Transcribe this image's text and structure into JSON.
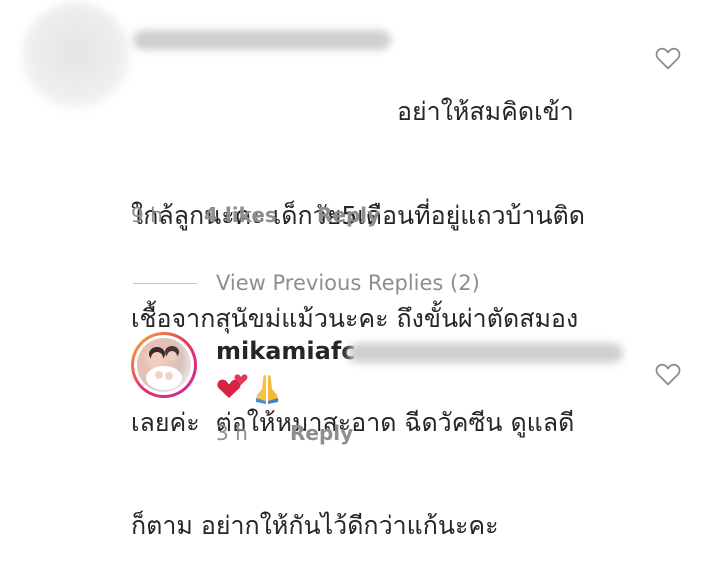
{
  "comment": {
    "lines": [
      "อย่าให้สมคิดเข้า",
      "ใกล้ลูกนะคะ เด็กวัย5เดือนที่อยู่แถวบ้านติด",
      "เชื้อจากสุนัขม่แม้วนะคะ ถึงขั้นผ่าตัดสมอง",
      "เลยค่ะ  ต่อให้หมาสะอาด ฉีดวัคซีน ดูแลดี",
      "ก็ตาม อย่ากให้กันไว้ดีกว่าแก้นะคะ"
    ],
    "time": "9 h",
    "likes": "4 likes",
    "reply_label": "Reply"
  },
  "view_previous_replies": "View Previous Replies (2)",
  "reply": {
    "username": "mikamiafc",
    "time": "3 h",
    "reply_label": "Reply",
    "emojis": [
      "heart-emoji",
      "praying-hands-emoji"
    ]
  },
  "icons": {
    "like": "heart-outline-icon"
  },
  "colors": {
    "text": "#262626",
    "muted": "#8e8e8e",
    "ring_start": "#f9b233",
    "ring_end": "#c32aa3"
  }
}
